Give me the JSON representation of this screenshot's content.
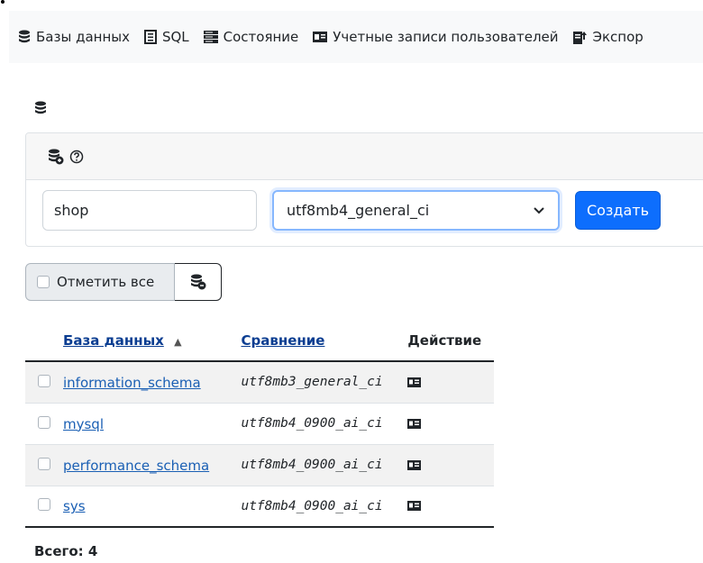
{
  "nav": {
    "items": [
      {
        "label": "Базы данных",
        "icon": "database-icon"
      },
      {
        "label": "SQL",
        "icon": "sql-icon"
      },
      {
        "label": "Состояние",
        "icon": "status-icon"
      },
      {
        "label": "Учетные записи пользователей",
        "icon": "user-accounts-icon"
      },
      {
        "label": "Экспор",
        "icon": "export-icon"
      }
    ]
  },
  "create_db": {
    "name_value": "shop",
    "collation_selected": "utf8mb4_general_ci",
    "create_label": "Создать"
  },
  "toolbar": {
    "check_all_label": "Отметить все"
  },
  "table": {
    "headers": {
      "database": "База данных",
      "collation": "Сравнение",
      "action": "Действие"
    },
    "rows": [
      {
        "name": "information_schema",
        "collation": "utf8mb3_general_ci"
      },
      {
        "name": "mysql",
        "collation": "utf8mb4_0900_ai_ci"
      },
      {
        "name": "performance_schema",
        "collation": "utf8mb4_0900_ai_ci"
      },
      {
        "name": "sys",
        "collation": "utf8mb4_0900_ai_ci"
      }
    ]
  },
  "footer": {
    "total": "Всего: 4"
  },
  "colors": {
    "primary": "#0d6efd",
    "link": "#1a5fb4",
    "nav_bg": "#f8f9fa"
  }
}
